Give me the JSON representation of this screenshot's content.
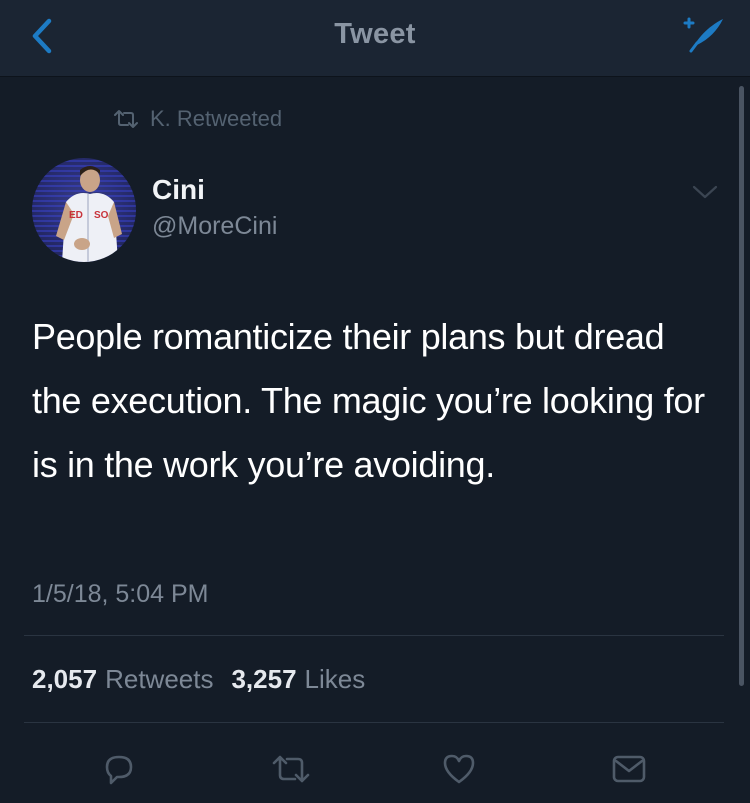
{
  "nav": {
    "title": "Tweet",
    "back_icon": "chevron-left-icon",
    "compose_icon": "compose-icon",
    "accent": "#1da1f2"
  },
  "retweet_context": {
    "text": "K. Retweeted",
    "icon": "retweet-icon"
  },
  "author": {
    "name": "Cini",
    "handle": "@MoreCini",
    "avatar_label": "RED SOX"
  },
  "tweet": {
    "text": "People romanticize their plans but dread the execution. The magic you’re looking for is in the work you’re avoiding.",
    "timestamp": "1/5/18, 5:04 PM"
  },
  "stats": {
    "retweets_count": "2,057",
    "retweets_label": "Retweets",
    "likes_count": "3,257",
    "likes_label": "Likes"
  },
  "actions": [
    "reply-icon",
    "retweet-icon",
    "like-icon",
    "message-icon"
  ],
  "colors": {
    "background": "#141c27",
    "navbar": "#1b2533",
    "secondary_text": "#7d8896"
  }
}
